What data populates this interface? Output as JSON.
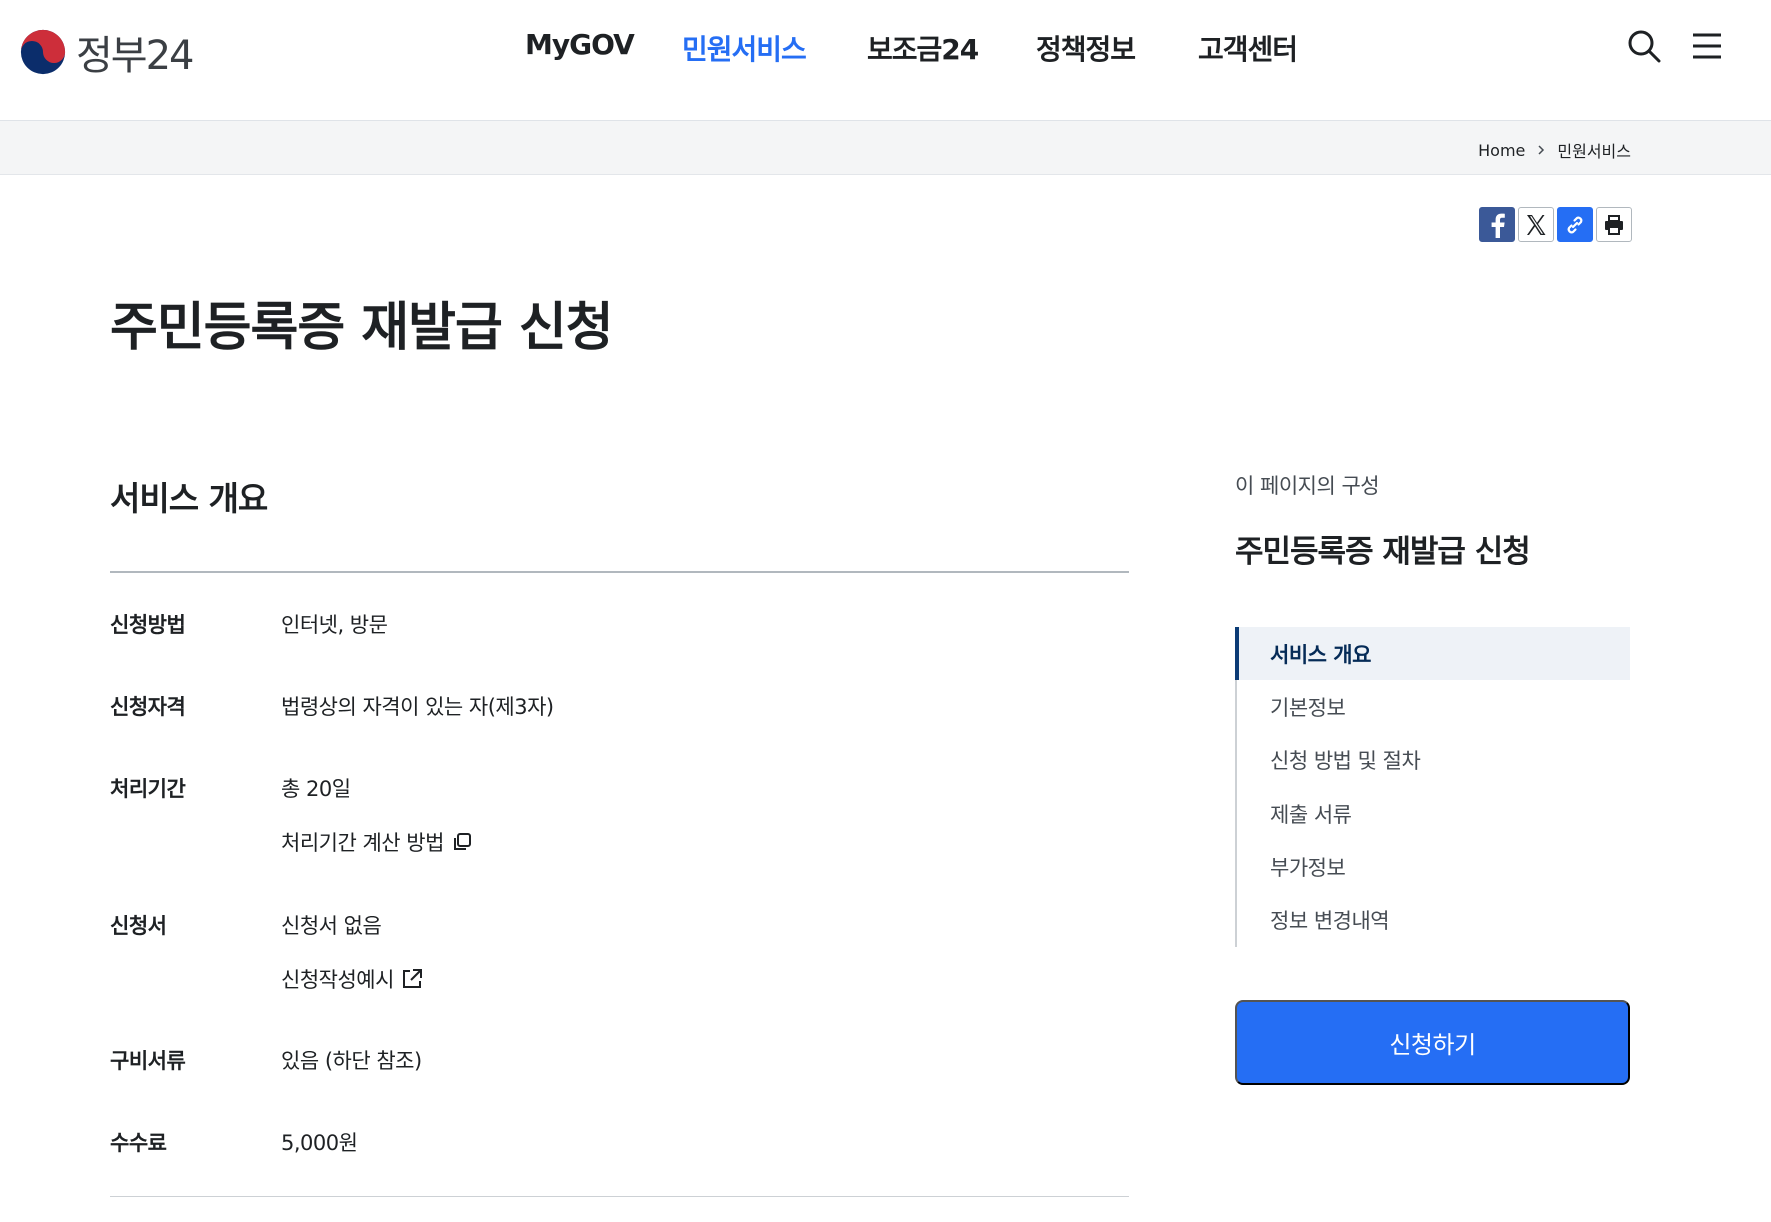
{
  "header": {
    "logo_text": "정부24",
    "nav": [
      {
        "label": "MyGOV",
        "active": false
      },
      {
        "label": "민원서비스",
        "active": true
      },
      {
        "label": "보조금24",
        "active": false
      },
      {
        "label": "정책정보",
        "active": false
      },
      {
        "label": "고객센터",
        "active": false
      }
    ],
    "icons": {
      "search": "search-icon",
      "menu": "hamburger-menu-icon"
    }
  },
  "breadcrumb": {
    "home": "Home",
    "current": "민원서비스"
  },
  "share": {
    "icons": [
      "facebook-icon",
      "x-twitter-icon",
      "link-icon",
      "print-icon"
    ]
  },
  "page": {
    "title": "주민등록증 재발급 신청"
  },
  "overview": {
    "section_title": "서비스 개요",
    "rows": [
      {
        "label": "신청방법",
        "value": "인터넷, 방문"
      },
      {
        "label": "신청자격",
        "value": "법령상의 자격이 있는 자(제3자)"
      },
      {
        "label": "처리기간",
        "value": "총 20일",
        "link": "처리기간 계산 방법"
      },
      {
        "label": "신청서",
        "value": "신청서 없음",
        "link": "신청작성예시"
      },
      {
        "label": "구비서류",
        "value": "있음 (하단 참조)"
      },
      {
        "label": "수수료",
        "value": "5,000원"
      }
    ]
  },
  "toc": {
    "caption": "이 페이지의 구성",
    "title": "주민등록증 재발급 신청",
    "items": [
      {
        "label": "서비스 개요",
        "active": true
      },
      {
        "label": "기본정보",
        "active": false
      },
      {
        "label": "신청 방법 및 절차",
        "active": false
      },
      {
        "label": "제출 서류",
        "active": false
      },
      {
        "label": "부가정보",
        "active": false
      },
      {
        "label": "정보 변경내역",
        "active": false
      }
    ]
  },
  "apply_button": "신청하기",
  "colors": {
    "accent": "#256ef4",
    "active_nav": "#256ef4",
    "toc_active_bg": "#eef2f7",
    "toc_active_bar": "#0b3b75"
  }
}
